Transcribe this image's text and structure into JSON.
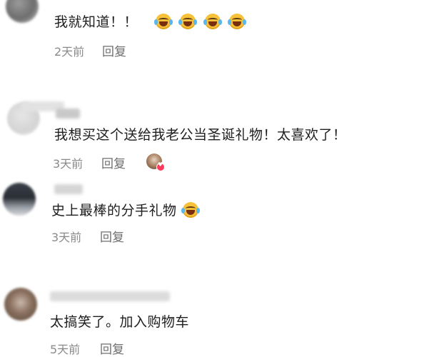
{
  "comments": [
    {
      "text": "我就知道！！",
      "emoji_count": 4,
      "emoji": "laughing-tears-emoji",
      "time": "2天前",
      "reply": "回复"
    },
    {
      "text": "我想买这个送给我老公当圣诞礼物！太喜欢了！",
      "time": "3天前",
      "reply": "回复",
      "liked_by_author": true
    },
    {
      "text": "史上最棒的分手礼物",
      "emoji_count": 1,
      "emoji": "laughing-tears-emoji",
      "time": "3天前",
      "reply": "回复"
    },
    {
      "text": "太搞笑了。加入购物车",
      "time": "5天前",
      "reply": "回复"
    }
  ],
  "colors": {
    "text": "#1e1e1e",
    "meta": "#8a8a8a",
    "like_badge": "#ff3b5c"
  }
}
